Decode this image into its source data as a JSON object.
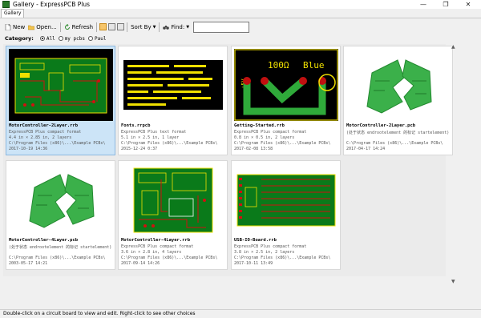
{
  "window": {
    "title": "Gallery - ExpressPCB Plus",
    "controls": [
      "—",
      "❐",
      "✕"
    ]
  },
  "tabs": [
    {
      "label": "Gallery"
    }
  ],
  "toolbar": {
    "new_label": "New",
    "open_label": "Open...",
    "refresh_label": "Refresh",
    "sort_label": "Sort By",
    "find_label": "Find:",
    "find_value": ""
  },
  "category": {
    "label": "Category:",
    "options": [
      {
        "label": "All",
        "selected": true
      },
      {
        "label": "my pcbs",
        "selected": false
      },
      {
        "label": "Paul",
        "selected": false
      }
    ]
  },
  "cards": [
    {
      "name": "MotorController-2Layer.rrb",
      "line1": "ExpressPCB Plus compact format",
      "line2": "4.4 in × 2.85 in, 2 layers",
      "line3": "C:\\Program Files (x86)\\...\\Example PCBs\\",
      "line4": "2017-10-19 14:36",
      "thumb": "pcb-green",
      "selected": true
    },
    {
      "name": "Fonts.rrpcb",
      "line1": "ExpressPCB Plus text format",
      "line2": "5.1 in × 2.5 in, 1 layer",
      "line3": "C:\\Program Files (x86)\\...\\Example PCBs\\",
      "line4": "2015-12-24 0:37",
      "thumb": "fonts-black",
      "selected": false
    },
    {
      "name": "Getting-Started.rrb",
      "line1": "ExpressPCB Plus compact format",
      "line2": "0.8 in × 0.5 in, 2 layers",
      "line3": "C:\\Program Files (x86)\\...\\Example PCBs\\",
      "line4": "2017-02-08 13:58",
      "thumb": "getting-started",
      "selected": false
    },
    {
      "name": "MotorController-2Layer.pcb",
      "line1": "(处于状态 endrootelement 的标记 startelement)",
      "line2": "",
      "line3": "C:\\Program Files (x86)\\...\\Example PCBs\\",
      "line4": "2017-04-17 14:24",
      "thumb": "broken",
      "selected": false
    },
    {
      "name": "MotorController-4Layer.pcb",
      "line1": "(处于状态 endrootelement 的标记 startelement)",
      "line2": "",
      "line3": "C:\\Program Files (x86)\\...\\Example PCBs\\",
      "line4": "2003-05-17 14:21",
      "thumb": "broken",
      "selected": false
    },
    {
      "name": "MotorController-4Layer.rrb",
      "line1": "ExpressPCB Plus compact format",
      "line2": "3.6 in × 2.8 in, 4 layers",
      "line3": "C:\\Program Files (x86)\\...\\Example PCBs\\",
      "line4": "2017-09-14 14:26",
      "thumb": "pcb-green4",
      "selected": false
    },
    {
      "name": "USB-IO-Board.rrb",
      "line1": "ExpressPCB Plus compact format",
      "line2": "3.8 in × 2.5 in, 2 layers",
      "line3": "C:\\Program Files (x86)\\...\\Example PCBs\\",
      "line4": "2017-10-11 13:49",
      "thumb": "usb-board",
      "selected": false
    }
  ],
  "getting_started_text": {
    "resistor": "100Ω",
    "color": "Blue",
    "plus5v": "+5V"
  },
  "colors": {
    "pcb_green": "#0a7a1a",
    "trace_yellow": "#f0e000",
    "pad_red": "#d01010",
    "accent_blue": "#cce4f7"
  },
  "status": {
    "text": "Double-click on a circuit board to view and edit. Right-click to see other choices"
  }
}
